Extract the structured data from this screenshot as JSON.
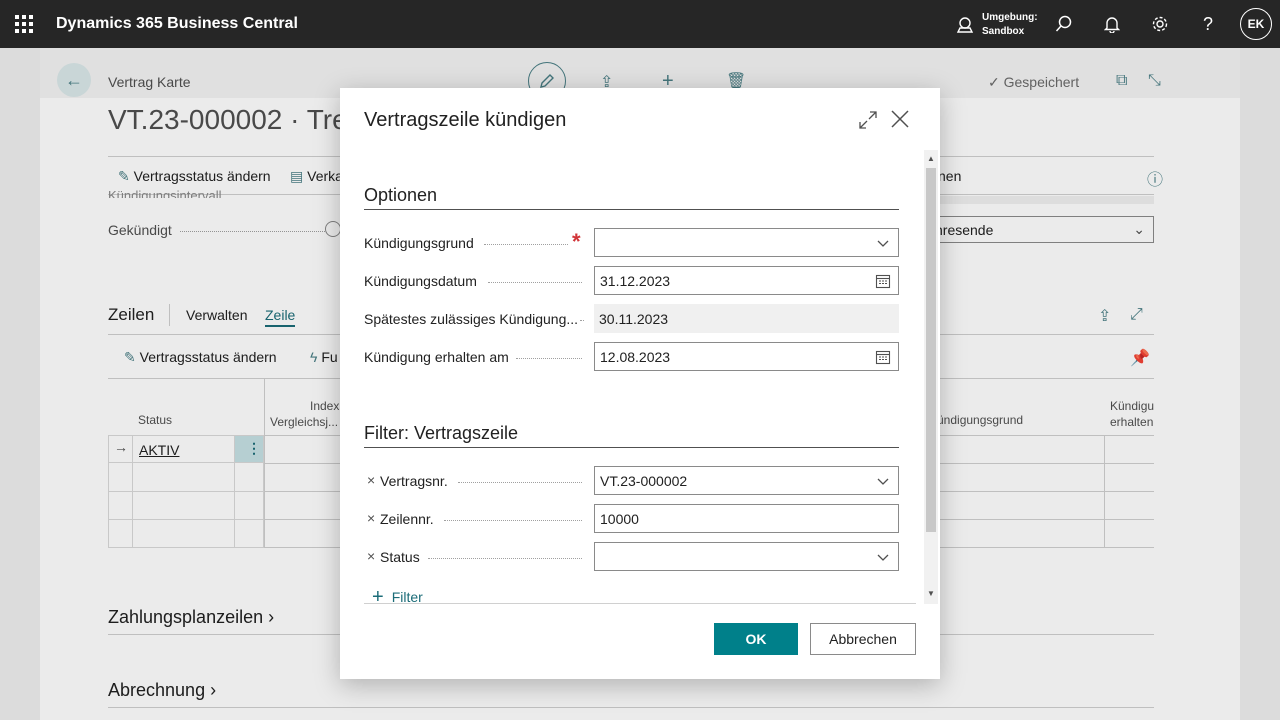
{
  "topbar": {
    "brand": "Dynamics 365 Business Central",
    "env_label": "Umgebung:",
    "env_value": "Sandbox",
    "avatar_initials": "EK"
  },
  "background": {
    "breadcrumb": "Vertrag Karte",
    "title": "VT.23-000002 · Tre",
    "saved": "Gespeichert",
    "actions": [
      "Vertragsstatus ändern",
      "Verka"
    ],
    "actions_right": "nen",
    "cut_label": "Kündigungsintervall",
    "gekuendigt": "Gekündigt",
    "dropdown_value": "nresende",
    "lines_title": "Zeilen",
    "lines_tabs": [
      "Verwalten",
      "Zeile"
    ],
    "lines_actions": [
      "Vertragsstatus ändern",
      "Fu"
    ],
    "grid_headers": {
      "status": "Status",
      "index": "Index",
      "vergleich": "Vergleichsj...",
      "kuendigungsgrund": "ündigungsgrund",
      "kuendigung": "Kündigu",
      "erhalten": "erhalten"
    },
    "grid_row_status": "AKTIV",
    "sections": [
      "Zahlungsplanzeilen",
      "Abrechnung"
    ]
  },
  "dialog": {
    "title": "Vertragszeile kündigen",
    "options_title": "Optionen",
    "fields": [
      {
        "label": "Kündigungsgrund",
        "value": "",
        "required": true
      },
      {
        "label": "Kündigungsdatum",
        "value": "31.12.2023"
      },
      {
        "label": "Spätestes zulässiges Kündigung...",
        "value": "30.11.2023"
      },
      {
        "label": "Kündigung erhalten am",
        "value": "12.08.2023"
      }
    ],
    "filter_title": "Filter: Vertragszeile",
    "filters": [
      {
        "label": "Vertragsnr.",
        "value": "VT.23-000002"
      },
      {
        "label": "Zeilennr.",
        "value": "10000"
      },
      {
        "label": "Status",
        "value": ""
      }
    ],
    "add_filter": "Filter",
    "ok": "OK",
    "cancel": "Abbrechen"
  },
  "colors": {
    "accent": "#00808a",
    "topbar": "#262626",
    "required": "#d13438"
  }
}
